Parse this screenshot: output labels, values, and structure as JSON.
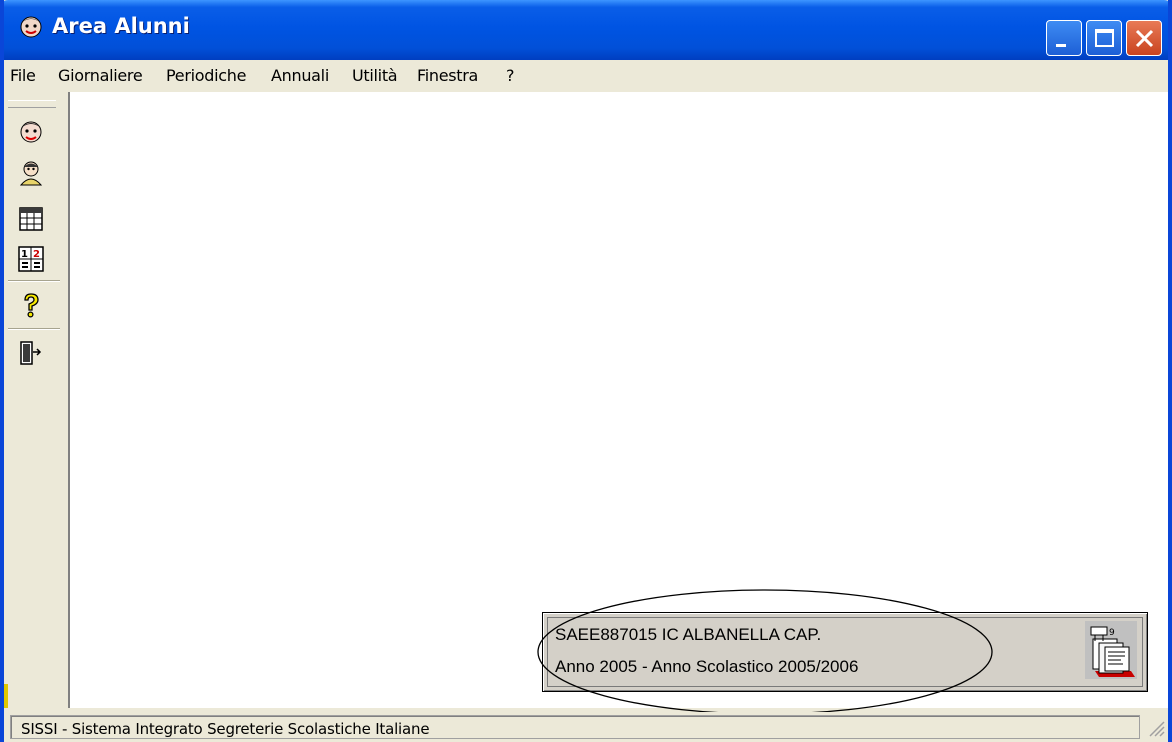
{
  "window": {
    "title": "Area Alunni",
    "icon": "student-face-icon",
    "controls": [
      "minimize-icon",
      "maximize-icon",
      "close-icon"
    ]
  },
  "menubar": {
    "items": [
      "File",
      "Giornaliere",
      "Periodiche",
      "Annuali",
      "Utilità",
      "Finestra",
      "?"
    ]
  },
  "toolbar": {
    "buttons": [
      {
        "icon": "student-face-icon"
      },
      {
        "icon": "person-icon"
      },
      {
        "icon": "calendar-grid-icon"
      },
      {
        "icon": "numbered-list-icon"
      },
      {
        "icon": "help-icon"
      },
      {
        "icon": "exit-door-icon"
      }
    ]
  },
  "info_panel": {
    "line1": "SAEE887015 IC ALBANELLA CAP.",
    "line2": "Anno 2005  -  Anno Scolastico 2005/2006",
    "icon": "school-documents-icon"
  },
  "statusbar": {
    "text": "SISSI - Sistema Integrato Segreterie Scolastiche Italiane"
  },
  "colors": {
    "titlebar": "#0054e3",
    "window_face": "#ece9d8",
    "workspace": "#ffffff",
    "panel_face": "#d4d0c8",
    "close_button": "#c94420"
  }
}
